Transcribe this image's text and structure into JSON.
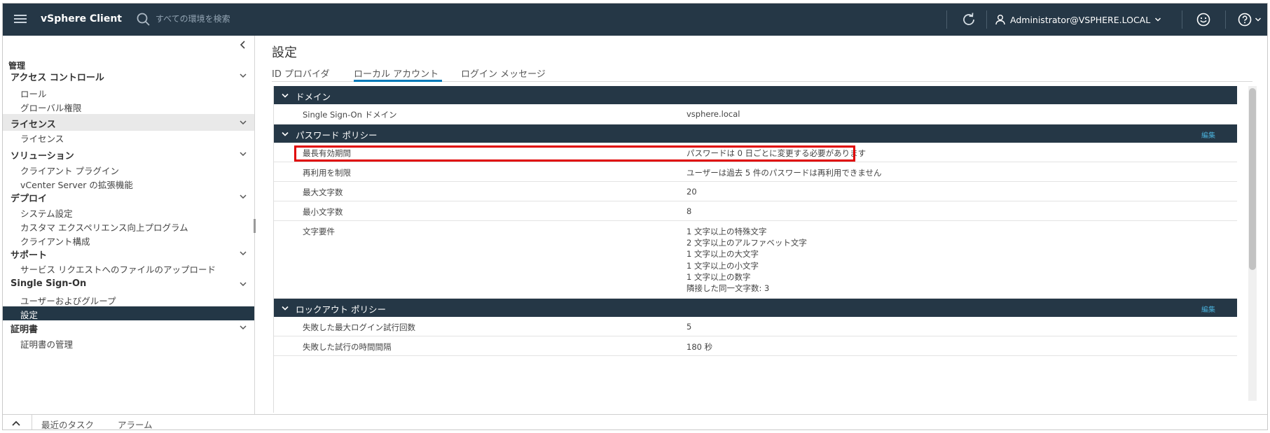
{
  "header": {
    "app_title": "vSphere Client",
    "search_placeholder": "すべての環境を検索",
    "user": "Administrator@VSPHERE.LOCAL"
  },
  "sidebar": {
    "heading": "管理",
    "sections": [
      {
        "label": "アクセス コントロール",
        "items": [
          "ロール",
          "グローバル権限"
        ]
      },
      {
        "label": "ライセンス",
        "items": [
          "ライセンス"
        ]
      },
      {
        "label": "ソリューション",
        "items": [
          "クライアント プラグイン",
          "vCenter Server の拡張機能"
        ]
      },
      {
        "label": "デプロイ",
        "items": [
          "システム設定",
          "カスタマ エクスペリエンス向上プログラム",
          "クライアント構成"
        ]
      },
      {
        "label": "サポート",
        "items": [
          "サービス リクエストへのファイルのアップロード"
        ]
      },
      {
        "label": "Single Sign-On",
        "items": [
          "ユーザーおよびグループ",
          "設定"
        ]
      },
      {
        "label": "証明書",
        "items": [
          "証明書の管理"
        ]
      }
    ],
    "selected_item": "設定"
  },
  "main": {
    "title": "設定",
    "tabs": [
      "ID プロバイダ",
      "ローカル アカウント",
      "ログイン メッセージ"
    ],
    "active_tab": "ローカル アカウント",
    "domain_section": {
      "title": "ドメイン",
      "rows": [
        {
          "key": "Single Sign-On ドメイン",
          "value": "vsphere.local"
        }
      ]
    },
    "password_section": {
      "title": "パスワード ポリシー",
      "edit": "編集",
      "rows": [
        {
          "key": "最長有効期間",
          "value": "パスワードは 0 日ごとに変更する必要があります"
        },
        {
          "key": "再利用を制限",
          "value": "ユーザーは過去 5 件のパスワードは再利用できません"
        },
        {
          "key": "最大文字数",
          "value": "20"
        },
        {
          "key": "最小文字数",
          "value": "8"
        }
      ],
      "char_req_key": "文字要件",
      "char_req_values": [
        "1 文字以上の特殊文字",
        "2 文字以上のアルファベット文字",
        "1 文字以上の大文字",
        "1 文字以上の小文字",
        "1 文字以上の数字",
        "隣接した同一文字数: 3"
      ]
    },
    "lockout_section": {
      "title": "ロックアウト ポリシー",
      "edit": "編集",
      "rows": [
        {
          "key": "失敗した最大ログイン試行回数",
          "value": "5"
        },
        {
          "key": "失敗した試行の時間間隔",
          "value": "180 秒"
        }
      ]
    }
  },
  "bottom": {
    "recent_tasks": "最近のタスク",
    "alarms": "アラーム"
  },
  "colors": {
    "header_bg": "#253746",
    "accent": "#0079b8",
    "highlight_box": "#e00000",
    "edit_link": "#49afd9"
  }
}
